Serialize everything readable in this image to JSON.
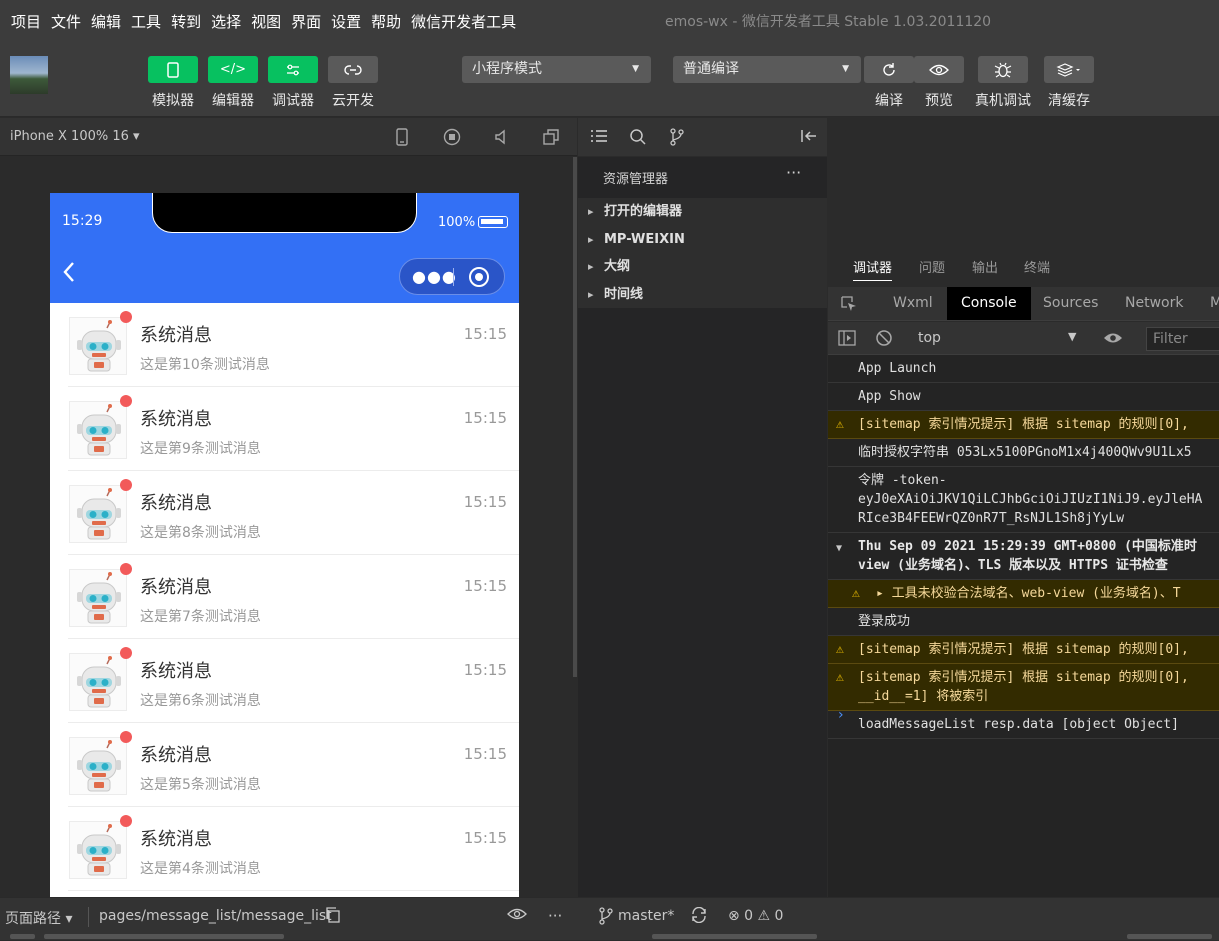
{
  "menu": {
    "items": [
      "项目",
      "文件",
      "编辑",
      "工具",
      "转到",
      "选择",
      "视图",
      "界面",
      "设置",
      "帮助",
      "微信开发者工具"
    ]
  },
  "window_title": "emos-wx - 微信开发者工具 Stable 1.03.2011120",
  "toolbar": {
    "simulator_label": "模拟器",
    "editor_label": "编辑器",
    "debugger_label": "调试器",
    "cloud_label": "云开发",
    "mode_select": "小程序模式",
    "compile_select": "普通编译",
    "compile_label": "编译",
    "preview_label": "预览",
    "device_debug_label": "真机调试",
    "clear_cache_label": "清缓存"
  },
  "simulator": {
    "device": "iPhone X 100% 16 ▾",
    "time": "15:29",
    "battery": "100%"
  },
  "messages": [
    {
      "title": "系统消息",
      "subtitle": "这是第10条测试消息",
      "time": "15:15"
    },
    {
      "title": "系统消息",
      "subtitle": "这是第9条测试消息",
      "time": "15:15"
    },
    {
      "title": "系统消息",
      "subtitle": "这是第8条测试消息",
      "time": "15:15"
    },
    {
      "title": "系统消息",
      "subtitle": "这是第7条测试消息",
      "time": "15:15"
    },
    {
      "title": "系统消息",
      "subtitle": "这是第6条测试消息",
      "time": "15:15"
    },
    {
      "title": "系统消息",
      "subtitle": "这是第5条测试消息",
      "time": "15:15"
    },
    {
      "title": "系统消息",
      "subtitle": "这是第4条测试消息",
      "time": "15:15"
    }
  ],
  "explorer": {
    "title": "资源管理器",
    "sections": [
      "打开的编辑器",
      "MP-WEIXIN",
      "大纲",
      "时间线"
    ]
  },
  "debug_tabs": [
    "调试器",
    "问题",
    "输出",
    "终端"
  ],
  "devtools_tabs": [
    "Wxml",
    "Console",
    "Sources",
    "Network",
    "M"
  ],
  "console": {
    "context": "top",
    "filter_placeholder": "Filter",
    "logs": [
      {
        "type": "info",
        "lines": [
          "App Launch"
        ]
      },
      {
        "type": "info",
        "lines": [
          "App Show"
        ]
      },
      {
        "type": "warn",
        "lines": [
          "[sitemap 索引情况提示] 根据 sitemap 的规则[0],"
        ]
      },
      {
        "type": "info",
        "lines": [
          "临时授权字符串 053Lx5100PGnoM1x4j400QWv9U1Lx5"
        ]
      },
      {
        "type": "info",
        "lines": [
          "令牌 -token-",
          "eyJ0eXAiOiJKV1QiLCJhbGciOiJIUzI1NiJ9.eyJleHA",
          "RIce3B4FEEWrQZ0nR7T_RsNJL1Sh8jYyLw"
        ]
      },
      {
        "type": "group",
        "lines": [
          "Thu Sep 09 2021 15:29:39 GMT+0800 (中国标准时",
          "view (业务域名)、TLS 版本以及 HTTPS 证书检查"
        ]
      },
      {
        "type": "warn-sub",
        "lines": [
          "▸ 工具未校验合法域名、web-view (业务域名)、T"
        ]
      },
      {
        "type": "info",
        "lines": [
          "登录成功"
        ]
      },
      {
        "type": "warn",
        "lines": [
          "[sitemap 索引情况提示] 根据 sitemap 的规则[0],"
        ]
      },
      {
        "type": "warn",
        "lines": [
          "[sitemap 索引情况提示] 根据 sitemap 的规则[0],",
          "__id__=1] 将被索引"
        ]
      },
      {
        "type": "info",
        "lines": [
          "loadMessageList resp.data [object Object]"
        ]
      }
    ]
  },
  "statusbar": {
    "path_label": "页面路径 ▾",
    "path": "pages/message_list/message_list",
    "branch": "master*",
    "counts": "⊗ 0 ⚠ 0"
  }
}
